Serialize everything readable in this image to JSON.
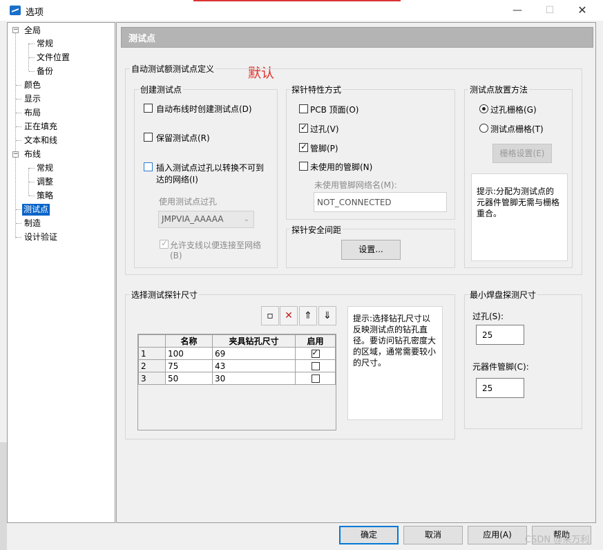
{
  "window": {
    "title": "选项",
    "minimize_glyph": "—",
    "maximize_glyph": "☐",
    "close_glyph": "✕"
  },
  "tree": {
    "expand_glyph": "−",
    "items": [
      {
        "label": "全局",
        "expandable": true
      },
      {
        "label": "常规"
      },
      {
        "label": "文件位置"
      },
      {
        "label": "备份"
      },
      {
        "label": "颜色"
      },
      {
        "label": "显示"
      },
      {
        "label": "布局"
      },
      {
        "label": "正在填充"
      },
      {
        "label": "文本和线"
      },
      {
        "label": "布线",
        "expandable": true
      },
      {
        "label": "常规"
      },
      {
        "label": "调整"
      },
      {
        "label": "策略"
      },
      {
        "label": "测试点",
        "selected": true
      },
      {
        "label": "制造"
      },
      {
        "label": "设计验证"
      }
    ]
  },
  "page": {
    "title": "测试点",
    "annotation": "默认",
    "auto_group": {
      "label": "自动测试额测试点定义",
      "create": {
        "label": "创建测试点",
        "auto_route": {
          "label": "自动布线时创建测试点(D)",
          "checked": false
        },
        "keep": {
          "label": "保留测试点(R)",
          "checked": false
        },
        "insert": {
          "label_line1": "插入测试点过孔以转换不可到",
          "label_line2": "达的网络(I)",
          "checked": false
        },
        "via_label": "使用测试点过孔",
        "via_value": "JMPVIA_AAAAA",
        "allow_stub": {
          "label_line1": "允许支线以便连接至网络",
          "label_line2": "(B)",
          "checked": true
        }
      },
      "probe": {
        "label": "探针特性方式",
        "pcb_top": {
          "label": "PCB 顶面(O)",
          "checked": false
        },
        "via": {
          "label": "过孔(V)",
          "checked": true
        },
        "pin": {
          "label": "管脚(P)",
          "checked": true
        },
        "unused_pin": {
          "label": "未使用的管脚(N)",
          "checked": false
        },
        "netname_label": "未使用管脚网络名(M):",
        "netname_value": "NOT_CONNECTED"
      },
      "clearance": {
        "label": "探针安全间距",
        "settings_button": "设置..."
      },
      "placement": {
        "label": "测试点放置方法",
        "via_grid": {
          "label": "过孔栅格(G)",
          "selected": true
        },
        "tp_grid": {
          "label": "测试点栅格(T)",
          "selected": false
        },
        "grid_settings_button": "栅格设置(E)",
        "hint": "提示:分配为测试点的元器件管脚无需与栅格重合。"
      }
    },
    "probe_size": {
      "label": "选择测试探针尺寸",
      "toolbar": {
        "new_glyph": "▫",
        "delete_glyph": "✕",
        "up_glyph": "⇑",
        "down_glyph": "⇓"
      },
      "columns": [
        "名称",
        "夹具钻孔尺寸",
        "启用"
      ],
      "rows": [
        {
          "index": "1",
          "name": "100",
          "drill": "69",
          "enabled": true
        },
        {
          "index": "2",
          "name": "75",
          "drill": "43",
          "enabled": false
        },
        {
          "index": "3",
          "name": "50",
          "drill": "30",
          "enabled": false
        }
      ],
      "hint": "提示:选择钻孔尺寸以反映测试点的钻孔直径。要访问钻孔密度大的区域，通常需要较小的尺寸。"
    },
    "min_pad": {
      "label": "最小焊盘探测尺寸",
      "via_label": "过孔(S):",
      "via_value": "25",
      "pin_label": "元器件管脚(C):",
      "pin_value": "25"
    }
  },
  "footer": {
    "ok": "确定",
    "cancel": "取消",
    "apply": "应用(A)",
    "help": "帮助"
  },
  "watermark": "CSDN @来万利",
  "colors": {
    "selection": "#0a64c8",
    "annotation": "#e0332d",
    "primary_border": "#0078d7"
  }
}
